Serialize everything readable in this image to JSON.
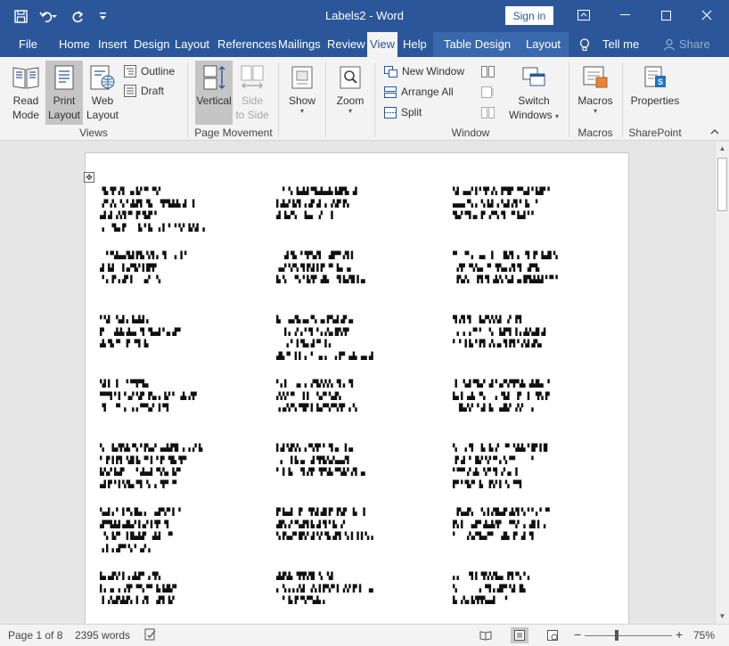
{
  "window": {
    "title": "Labels2",
    "app_name": "Word",
    "title_separator": "-",
    "sign_in_label": "Sign in"
  },
  "menu_tabs": {
    "file": "File",
    "home": "Home",
    "insert": "Insert",
    "design": "Design",
    "layout": "Layout",
    "references": "References",
    "mailings": "Mailings",
    "review": "Review",
    "view": "View",
    "help": "Help",
    "table_design": "Table Design",
    "table_layout": "Layout",
    "tell_me": "Tell me",
    "share": "Share"
  },
  "ribbon": {
    "views": {
      "read_mode": [
        "Read",
        "Mode"
      ],
      "print_layout": [
        "Print",
        "Layout"
      ],
      "web_layout": [
        "Web",
        "Layout"
      ],
      "outline": "Outline",
      "draft": "Draft",
      "group_label": "Views"
    },
    "page_movement": {
      "vertical": "Vertical",
      "side_to_side": [
        "Side",
        "to Side"
      ],
      "group_label": "Page Movement"
    },
    "show": {
      "label": "Show"
    },
    "zoom": {
      "label": "Zoom"
    },
    "window": {
      "new_window": "New Window",
      "arrange_all": "Arrange All",
      "split": "Split",
      "switch_windows": [
        "Switch",
        "Windows"
      ],
      "group_label": "Window"
    },
    "macros": {
      "label": "Macros",
      "group_label": "Macros"
    },
    "sharepoint": {
      "label": "Properties",
      "group_label": "SharePoint"
    }
  },
  "status_bar": {
    "page": "Page 1 of 8",
    "words": "2395 words",
    "zoom_level": "75%",
    "zoom_minus": "−",
    "zoom_plus": "+"
  },
  "icons": {
    "save": "save-icon",
    "undo": "undo-icon",
    "redo": "redo-icon",
    "customize": "customize-qat-icon",
    "lightbulb": "lightbulb-icon",
    "share": "person-share-icon"
  },
  "colors": {
    "brand": "#2b579a",
    "context_tab": "#3a68ad",
    "ribbon_bg": "#f3f3f3",
    "pressed": "#c5c5c5"
  }
}
